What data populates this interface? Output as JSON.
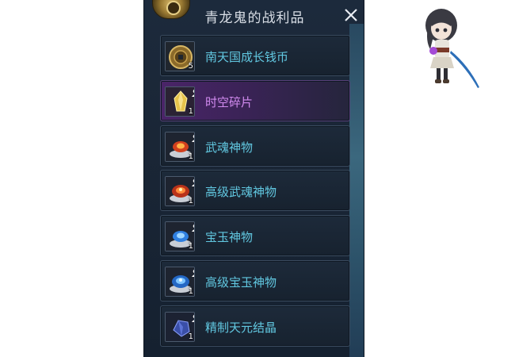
{
  "panel": {
    "title": "青龙鬼的战利品",
    "close_icon": "close-x-icon",
    "emblem_icon": "gold-emblem-icon"
  },
  "colors": {
    "item_name": "#61c7e0",
    "rare_item_name": "#d28bf0",
    "panel_bg": "#1a2636"
  },
  "items": [
    {
      "name": "南天国成长钱币",
      "qty": "5",
      "icon": "coin-icon",
      "rarity": "normal"
    },
    {
      "name": "时空碎片",
      "qty": "1",
      "icon": "gold-crystal-icon",
      "rarity": "rare"
    },
    {
      "name": "武魂神物",
      "qty": "1",
      "icon": "red-relic-icon",
      "rarity": "normal"
    },
    {
      "name": "高级武魂神物",
      "qty": "1",
      "icon": "red-relic-advanced-icon",
      "rarity": "normal"
    },
    {
      "name": "宝玉神物",
      "qty": "1",
      "icon": "blue-relic-icon",
      "rarity": "normal"
    },
    {
      "name": "高级宝玉神物",
      "qty": "1",
      "icon": "blue-relic-advanced-icon",
      "rarity": "normal"
    },
    {
      "name": "精制天元结晶",
      "qty": "1",
      "icon": "refined-crystal-icon",
      "rarity": "normal"
    }
  ],
  "mascot": {
    "icon": "chibi-swordswoman-icon"
  }
}
